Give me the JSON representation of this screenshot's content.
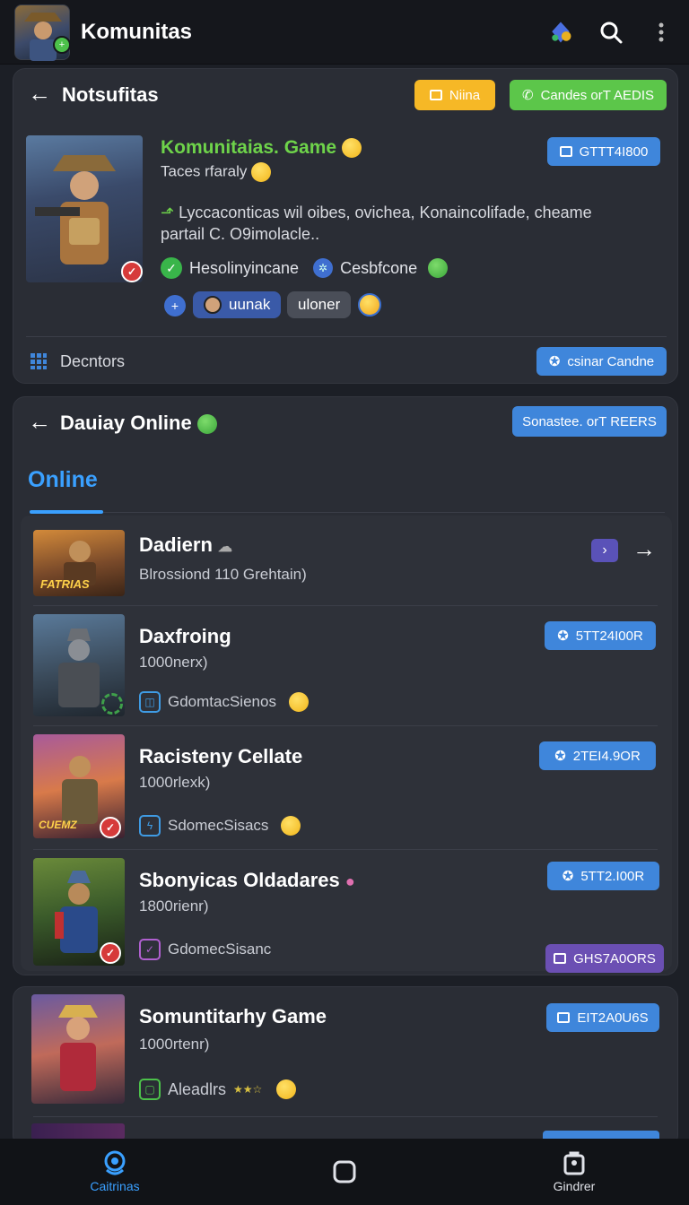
{
  "app": {
    "title": "Komunitas"
  },
  "card1": {
    "header_title": "Notsufitas",
    "btn_yellow": "Niina",
    "btn_green": "Candes orT AEDIS",
    "game_title": "Komunitaias. Game",
    "game_subtitle": "Taces rfaraly",
    "id_button": "GTTT4I800",
    "desc_line1": "Lyccaconticas wil oibes, ovichea, Konaincolifade, cheame",
    "desc_line2": "partail C. O9imolacle..",
    "tag1": "Hesolinyincane",
    "tag2": "Cesbfcone",
    "chip1": "uunak",
    "chip2": "uloner",
    "footer_label": "Decntors",
    "footer_button": "csinar Candne"
  },
  "card2": {
    "header_title": "Dauiay Online",
    "header_button": "Sonastee. orT REERS",
    "tab_active": "Online",
    "rows": [
      {
        "title": "Dadiern",
        "subtitle": "Blrossiond 110 Grehtain)",
        "art_label": "FATRIAS"
      },
      {
        "title": "Daxfroing",
        "subtitle": "1000nerx)",
        "tag": "GdomtacSienos",
        "button": "5TT24I00R"
      },
      {
        "title": "Racisteny Cellate",
        "subtitle": "1000rlexk)",
        "tag": "SdomecSisacs",
        "button": "2TEI4.9OR",
        "art_label": "CUEMZ"
      },
      {
        "title": "Sbonyicas Oldadares",
        "subtitle": "1800rienr)",
        "tag": "GdomecSisanc",
        "button": "5TT2.I00R",
        "button2": "GHS7A0ORS"
      }
    ]
  },
  "card3": {
    "title": "Somuntitarhy Game",
    "subtitle": "1000rtenr)",
    "tag": "Aleadlrs",
    "button": "EIT2A0U6S"
  },
  "bottom_nav": {
    "left": "Caitrinas",
    "right": "Gindrer"
  },
  "colors": {
    "accent_blue": "#3f86db",
    "accent_green": "#5cc64a",
    "accent_yellow": "#f6b826",
    "game_title_green": "#6ed34a",
    "tab_blue": "#3aa0ff"
  }
}
